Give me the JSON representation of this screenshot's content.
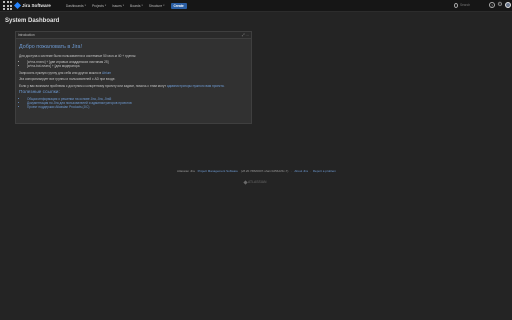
{
  "topnav": {
    "logo_text": "Jira Software",
    "menu": [
      {
        "label": "Dashboards"
      },
      {
        "label": "Projects"
      },
      {
        "label": "Issues"
      },
      {
        "label": "Boards"
      },
      {
        "label": "Structure"
      }
    ],
    "create_label": "Create",
    "search_placeholder": "Search",
    "help_glyph": "?",
    "settings_glyph": "⚙"
  },
  "page": {
    "title": "System Dashboard"
  },
  "gadget": {
    "title": "Introduction",
    "actions_glyph": "⤢ ⋯",
    "heading": "Добро пожаловать в Jira!",
    "lines": {
      "intro": "Для доступа к системе были пользователи и системные 50 кв.ю.м 40 + группы:",
      "bullet1": "[a+на-плато] + [две игровых аладдинских листинам 25]",
      "bullet2": "[a+на-bot-плато] + [для модератора",
      "req1_pre": "Запросить нужную группу для себя или других можно в ",
      "req1_link": "Atrium",
      "req2": "Jira синхронизирует все группы и пользователей с AD при входе.",
      "req3_pre": "Если у вас возникли проблемы с доступом к конкретному проекту или задаче, помочь с этим могут ",
      "req3_link": "администраторы нужного вам проекта."
    },
    "subheading": "Полезные ссылки:",
    "links": [
      "Общая информация о решении на основе Jira, Jira, Jira5",
      "Документация по Jira для пользователей и администраторов проектов",
      "Проект поддержки Atlassian Products (JIC)"
    ]
  },
  "footer": {
    "line_prefix": "Atlassian Jira ",
    "line_link": "Project Management Software",
    "line_version": " (v8.20.7#820007-sha1:0d56dc5c-7)",
    "sep": "·",
    "about": "About Jira",
    "report": "Report a problem",
    "brand": "ATLASSIAN"
  }
}
